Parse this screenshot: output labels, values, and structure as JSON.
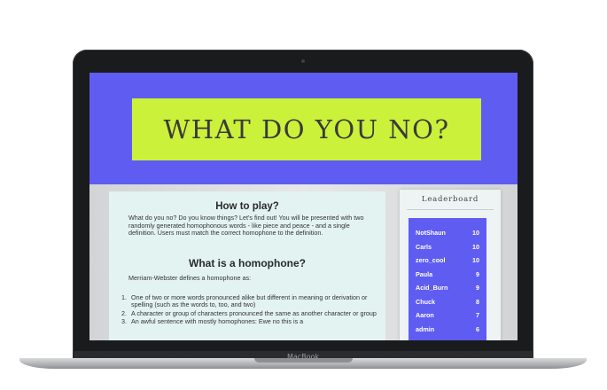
{
  "device": {
    "brand": "MacBook"
  },
  "hero": {
    "title": "WHAT DO YOU NO?"
  },
  "how_to": {
    "heading": "How to play?",
    "intro": "What do you no? Do you know things? Let's find out! You will be presented with two randomly generated homophonous words - like piece and peace - and a single definition. Users must match the correct homophone to the definition."
  },
  "homophone": {
    "heading": "What is a homophone?",
    "intro": "Merriam-Webster defines a homophone as:",
    "definitions": [
      "One of two or more words pronounced alike but different in meaning or derivation or spelling (such as the words to, too, and two)",
      "A character or group of characters pronounced the same as another character or group",
      "An awful sentence with mostly homophones: Ewe no this is a"
    ]
  },
  "leaderboard": {
    "title": "Leaderboard",
    "entries": [
      {
        "name": "NotShaun",
        "score": "10"
      },
      {
        "name": "Carls",
        "score": "10"
      },
      {
        "name": "zero_cool",
        "score": "10"
      },
      {
        "name": "Paula",
        "score": "9"
      },
      {
        "name": "Acid_Burn",
        "score": "9"
      },
      {
        "name": "Chuck",
        "score": "8"
      },
      {
        "name": "Aaron",
        "score": "7"
      },
      {
        "name": "admin",
        "score": "6"
      }
    ]
  },
  "colors": {
    "hero_bg": "#5f5cf2",
    "title_bg": "#ccf13a",
    "card_bg": "#e3f3f1"
  }
}
